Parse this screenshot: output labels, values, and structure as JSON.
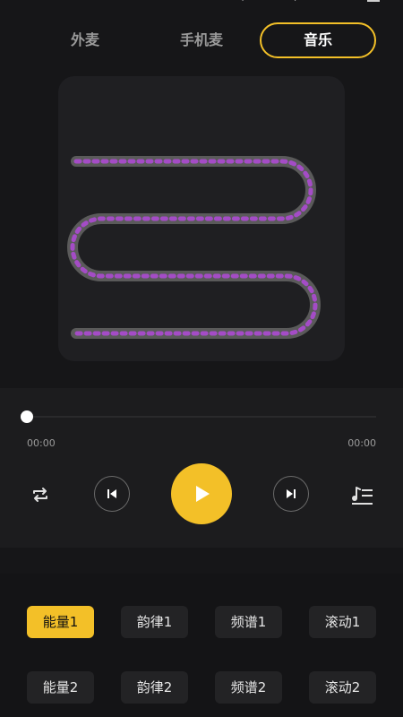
{
  "tabs": [
    "外麦",
    "手机麦",
    "音乐"
  ],
  "active_tab": "音乐",
  "player": {
    "time_current": "00:00",
    "time_total": "00:00",
    "progress": 0
  },
  "effects": [
    [
      "能量1",
      "韵律1",
      "频谱1",
      "滚动1"
    ],
    [
      "能量2",
      "韵律2",
      "频谱2",
      "滚动2"
    ]
  ],
  "active_effect": "能量1",
  "colors": {
    "accent": "#f3c028",
    "background": "#161618",
    "visual_path": "#5a5a5a",
    "visual_dots": "#a44cc6"
  },
  "icons": {
    "repeat": "repeat-icon",
    "previous": "skip-previous-icon",
    "play": "play-icon",
    "next": "skip-next-icon",
    "playlist": "playlist-icon"
  }
}
